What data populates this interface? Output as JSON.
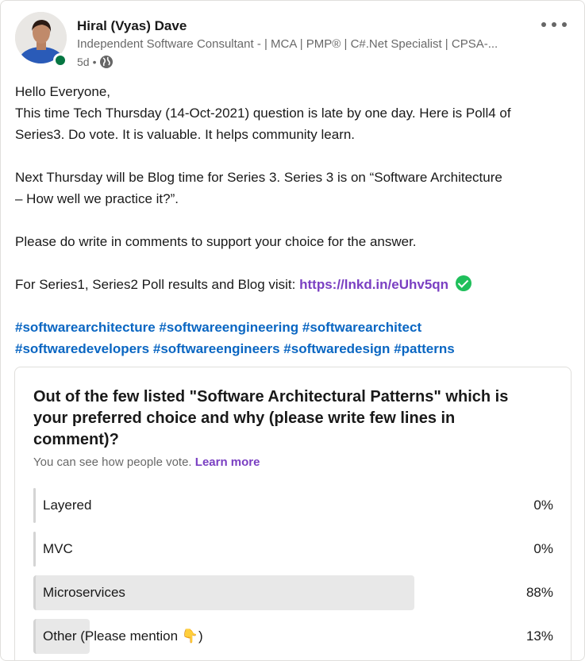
{
  "post": {
    "author_name": "Hiral (Vyas) Dave",
    "author_headline": "Independent Software Consultant - | MCA | PMP® | C#.Net Specialist | CPSA-...",
    "age": "5d",
    "separator": "•",
    "visibility_icon": "globe-icon",
    "menu_icon": "more-options-icon",
    "online_status_color": "#057642",
    "body": {
      "line1": "Hello Everyone,",
      "line2": "This time Tech Thursday (14-Oct-2021) question is late by one day. Here is Poll4 of",
      "line3": "Series3. Do vote. It is valuable. It helps community learn.",
      "line4": "Next Thursday will be Blog time for Series 3. Series 3 is on “Software Architecture",
      "line5": "– How well we practice it?”.",
      "line6": "Please do write in comments to support your choice for the answer.",
      "line7_prefix": "For Series1, Series2 Poll results and Blog visit:",
      "link": "https://lnkd.in/eUhv5qn",
      "link_icon": "check-circle-icon"
    },
    "hashtags_line1": [
      "#softwarearchitecture",
      "#softwareengineering",
      "#softwarearchitect"
    ],
    "hashtags_line2": [
      "#softwaredevelopers",
      "#softwareengineers",
      "#softwaredesign",
      "#patterns"
    ],
    "colors": {
      "link": "#7a3fc2",
      "hashtag": "#0a66c2"
    }
  },
  "poll": {
    "question_line1": "Out of the few listed \"Software Architectural Patterns\" which is",
    "question_line2": "your preferred choice and why (please write few lines in",
    "question_line3": "comment)?",
    "note": "You can see how people vote.",
    "learn_more": "Learn more",
    "options": [
      {
        "label": "Layered",
        "percent_text": "0%",
        "percent": 0
      },
      {
        "label": "MVC",
        "percent_text": "0%",
        "percent": 0
      },
      {
        "label": "Microservices",
        "percent_text": "88%",
        "percent": 88
      },
      {
        "label": "Other (Please mention 👇)",
        "percent_text": "13%",
        "percent": 13
      }
    ]
  }
}
